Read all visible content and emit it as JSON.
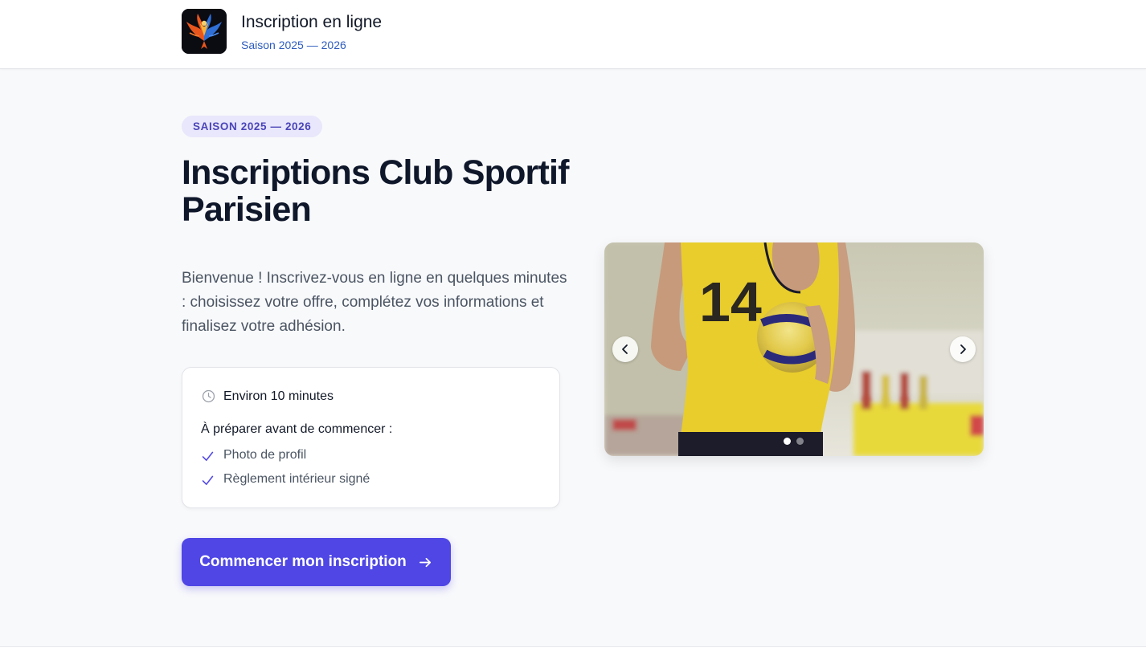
{
  "header": {
    "title": "Inscription en ligne",
    "subtitle": "Saison 2025 — 2026",
    "logo_icon": "phoenix-logo"
  },
  "hero": {
    "badge": "SAISON 2025 — 2026",
    "title": "Inscriptions Club Sportif Parisien",
    "intro": "Bienvenue ! Inscrivez-vous en ligne en quelques minutes : choisissez votre offre, complétez vos informations et finalisez votre adhésion."
  },
  "info_card": {
    "duration": "Environ 10 minutes",
    "duration_icon": "clock-icon",
    "prep_title": "À préparer avant de commencer :",
    "items": [
      {
        "label": "Photo de profil",
        "icon": "check-icon"
      },
      {
        "label": "Règlement intérieur signé",
        "icon": "check-icon"
      }
    ]
  },
  "cta": {
    "label": "Commencer mon inscription",
    "icon": "arrow-right-icon"
  },
  "carousel": {
    "image_subject": "volleyball player in yellow jersey number 14",
    "slides": 2,
    "active_slide": 1,
    "prev_icon": "chevron-left-icon",
    "next_icon": "chevron-right-icon"
  },
  "colors": {
    "accent": "#4f46e5",
    "badge_bg": "#e8e7fb",
    "badge_text": "#4b44b9",
    "subtitle_link": "#2d5bbd"
  }
}
